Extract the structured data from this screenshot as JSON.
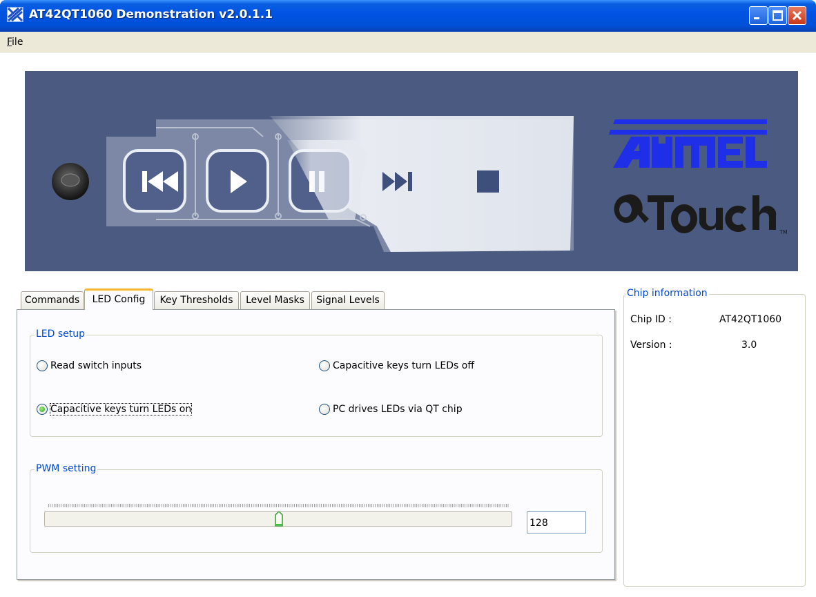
{
  "window": {
    "title": "AT42QT1060 Demonstration v2.0.1.1",
    "minimize_icon": "minimize-icon",
    "maximize_icon": "maximize-icon",
    "close_icon": "close-icon"
  },
  "menu": {
    "file_mnemonic": "F",
    "file_rest": "ile"
  },
  "banner": {
    "brand": "ATMEL",
    "product": "QTouch",
    "tm": "TM",
    "icons": [
      "previous-icon",
      "play-icon",
      "pause-icon",
      "next-icon",
      "stop-icon"
    ]
  },
  "tabs": [
    {
      "label": "Commands",
      "active": false
    },
    {
      "label": "LED Config",
      "active": true
    },
    {
      "label": "Key Thresholds",
      "active": false
    },
    {
      "label": "Level Masks",
      "active": false
    },
    {
      "label": "Signal Levels",
      "active": false
    }
  ],
  "led_setup": {
    "title": "LED setup",
    "options": [
      {
        "label": "Read switch inputs",
        "selected": false
      },
      {
        "label": "Capacitive keys turn LEDs off",
        "selected": false
      },
      {
        "label": "Capacitive keys turn LEDs on",
        "selected": true
      },
      {
        "label": "PC drives LEDs via QT chip",
        "selected": false
      }
    ]
  },
  "pwm": {
    "title": "PWM setting",
    "value": "128",
    "min": 0,
    "max": 255
  },
  "chip_info": {
    "title": "Chip information",
    "chip_id_label": "Chip ID :",
    "chip_id_value": "AT42QT1060",
    "version_label": "Version :",
    "version_value": "3.0"
  },
  "colors": {
    "title_bar": "#0054e3",
    "banner_bg": "#4b5a81",
    "atmel_blue": "#1f2fe8",
    "legend_blue": "#0046d5",
    "tab_highlight": "#f6b52d"
  }
}
